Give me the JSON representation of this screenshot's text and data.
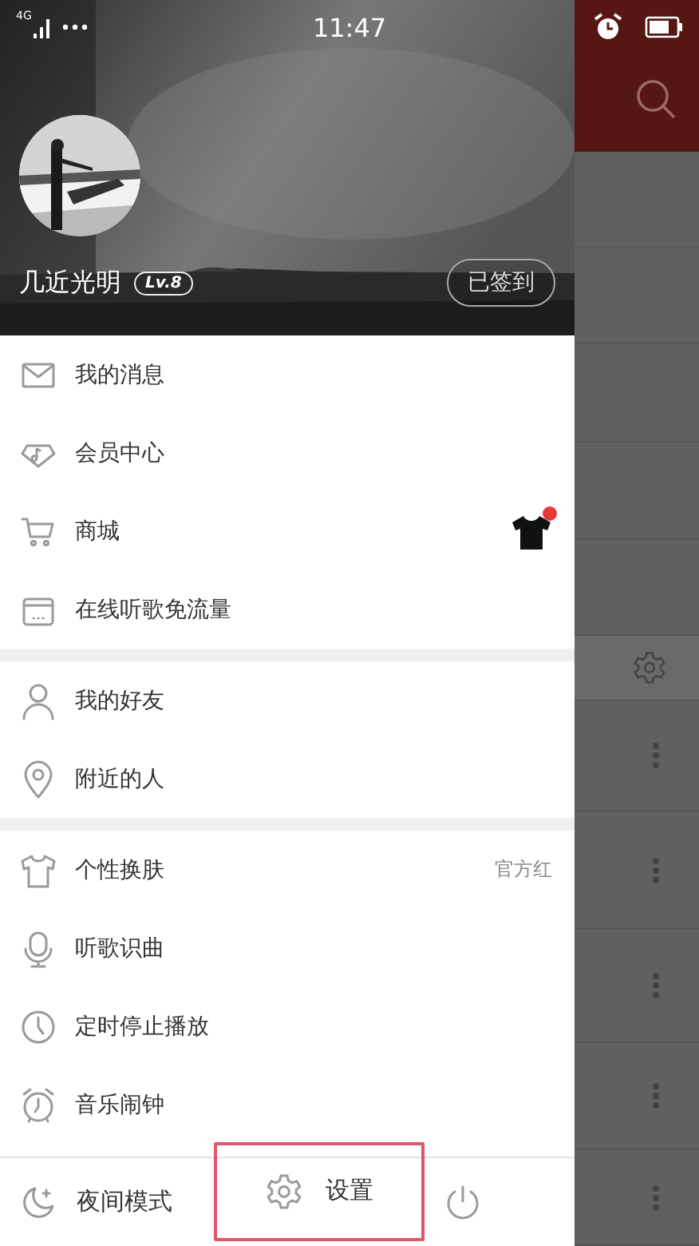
{
  "status_bar": {
    "network": "4G",
    "time": "11:47"
  },
  "profile": {
    "name": "几近光明",
    "level_badge": "Lv.8",
    "checkin_button": "已签到"
  },
  "menu_groups": [
    {
      "items": [
        {
          "kind": "mail",
          "label": "我的消息"
        },
        {
          "kind": "vip",
          "label": "会员中心"
        },
        {
          "kind": "cart",
          "label": "商城",
          "has_notification": true
        },
        {
          "kind": "sim",
          "label": "在线听歌免流量"
        }
      ]
    },
    {
      "items": [
        {
          "kind": "person",
          "label": "我的好友"
        },
        {
          "kind": "pin",
          "label": "附近的人"
        }
      ]
    },
    {
      "items": [
        {
          "kind": "shirt",
          "label": "个性换肤",
          "value": "官方红"
        },
        {
          "kind": "mic",
          "label": "听歌识曲"
        },
        {
          "kind": "clock",
          "label": "定时停止播放"
        },
        {
          "kind": "alarm",
          "label": "音乐闹钟"
        }
      ]
    }
  ],
  "bottom_bar": [
    {
      "kind": "night",
      "label": "夜间模式",
      "highlighted": false
    },
    {
      "kind": "settings",
      "label": "设置",
      "highlighted": true
    },
    {
      "kind": "power",
      "highlighted": false
    }
  ]
}
